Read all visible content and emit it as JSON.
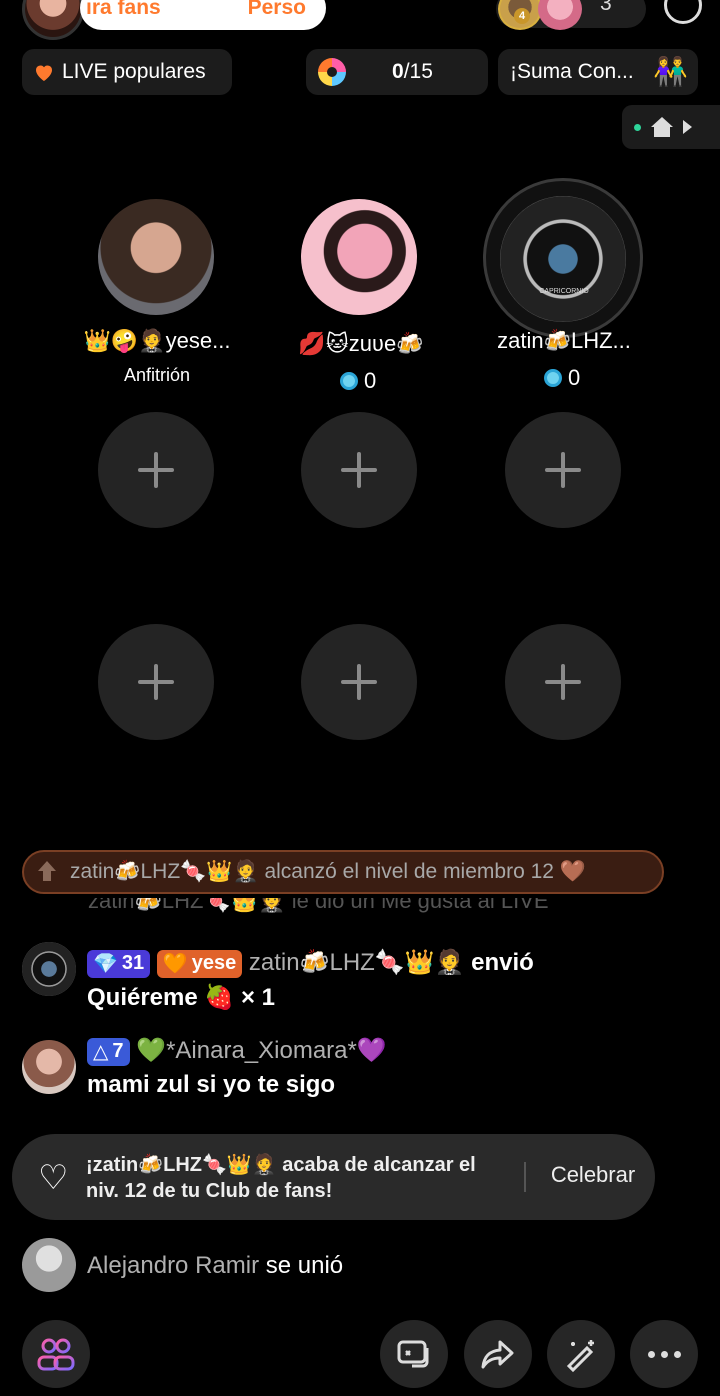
{
  "header": {
    "pill_left": "ıra fans",
    "pill_right": "Perso",
    "viewer_badge": "4",
    "viewer_count": "3"
  },
  "row2": {
    "live_label": "LIVE populares",
    "progress_current": "0",
    "progress_total": "/15",
    "suma_label": "¡Suma Con...",
    "people_emoji": "👫"
  },
  "guests": [
    {
      "name": "👑🤪🤵yese...",
      "sub": "Anfitrión"
    },
    {
      "name": "💋🐱zuʋe🍻",
      "coins": "0"
    },
    {
      "name": "zatin🍻LHZ...",
      "coins": "0",
      "frame_text": "CAPRICORNIO"
    }
  ],
  "chat": {
    "banner": "zatin🍻LHZ🍬👑🤵 alcanzó el nivel de miembro 12 🤎",
    "ghost": "zatin🍻LHZ🍬👑🤵 le dio un Me gusta al LIVE",
    "msg1": {
      "gem_level": "31",
      "fan_badge": "yese",
      "user": "zatin🍻LHZ🍬👑🤵",
      "action": "envió",
      "gift": "Quiéreme 🍓 × 1"
    },
    "msg2": {
      "level": "7",
      "user": "💚*Ainara_Xiomara*💜",
      "text": "mami zul si yo te sigo"
    },
    "msg3": {
      "user": "Alejandro Ramir",
      "action": "se unió"
    }
  },
  "toast": {
    "text": "¡zatin🍻LHZ🍬👑🤵 acaba de alcanzar el niv. 12 de tu Club de fans!",
    "button": "Celebrar"
  },
  "colors": {
    "accent_orange": "#ff7a2e",
    "coin_blue": "#6fd3f0",
    "badge_purple": "#4a3ad8"
  }
}
